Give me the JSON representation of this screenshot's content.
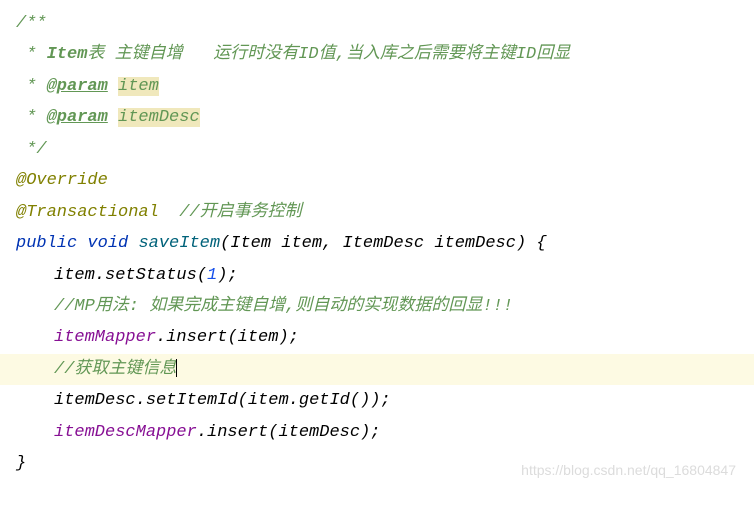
{
  "code": {
    "doc": {
      "open": "/**",
      "l1_prefix": " * ",
      "l1_item": "Item",
      "l1_rest": "表 主键自增   运行时没有ID值,当入库之后需要将主键ID回显",
      "l2_prefix": " * ",
      "l2_tag": "@param",
      "l2_space": " ",
      "l2_name": "item",
      "l3_prefix": " * ",
      "l3_tag": "@param",
      "l3_space": " ",
      "l3_name": "itemDesc",
      "close": " */"
    },
    "ann1": "@Override",
    "ann2": "@Transactional",
    "ann2_comment": "  //开启事务控制",
    "sig": {
      "kw_public": "public",
      "kw_void": "void",
      "method": "saveItem",
      "p1_type": "Item",
      "p1_name": "item",
      "p2_type": "ItemDesc",
      "p2_name": "itemDesc"
    },
    "body": {
      "l1_obj": "item",
      "l1_method": "setStatus",
      "l1_arg": "1",
      "l2_comment": "//MP用法: 如果完成主键自增,则自动的实现数据的回显!!!",
      "l3_obj": "itemMapper",
      "l3_method": "insert",
      "l3_arg": "item",
      "l4_comment": "//获取主键信息",
      "l5_obj": "itemDesc",
      "l5_method": "setItemId",
      "l5_inner_obj": "item",
      "l5_inner_method": "getId",
      "l6_obj": "itemDescMapper",
      "l6_method": "insert",
      "l6_arg": "itemDesc"
    }
  },
  "watermark": "https://blog.csdn.net/qq_16804847"
}
